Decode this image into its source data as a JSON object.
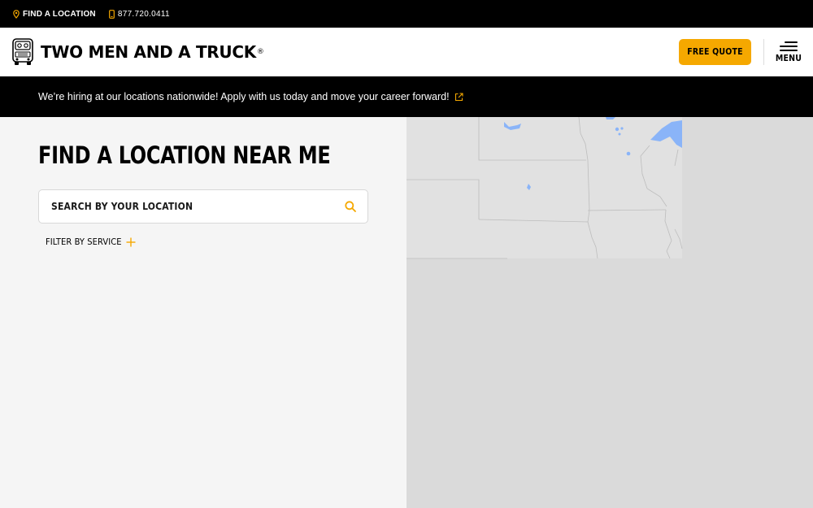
{
  "topbar": {
    "find_location": "FIND A LOCATION",
    "phone": "877.720.0411"
  },
  "header": {
    "brand": "TWO MEN AND A TRUCK",
    "registered": "®",
    "quote_label": "FREE QUOTE",
    "menu_label": "MENU"
  },
  "banner": {
    "text": "We’re hiring at our locations nationwide! Apply with us today and move your career forward!"
  },
  "main": {
    "title": "FIND A LOCATION NEAR ME",
    "search_placeholder": "SEARCH BY YOUR LOCATION",
    "filter_label": "FILTER BY SERVICE"
  },
  "colors": {
    "accent": "#f5a800",
    "black": "#000000",
    "panel": "#f5f5f5",
    "map_land": "#dadada",
    "map_water": "#8ab4f8"
  }
}
